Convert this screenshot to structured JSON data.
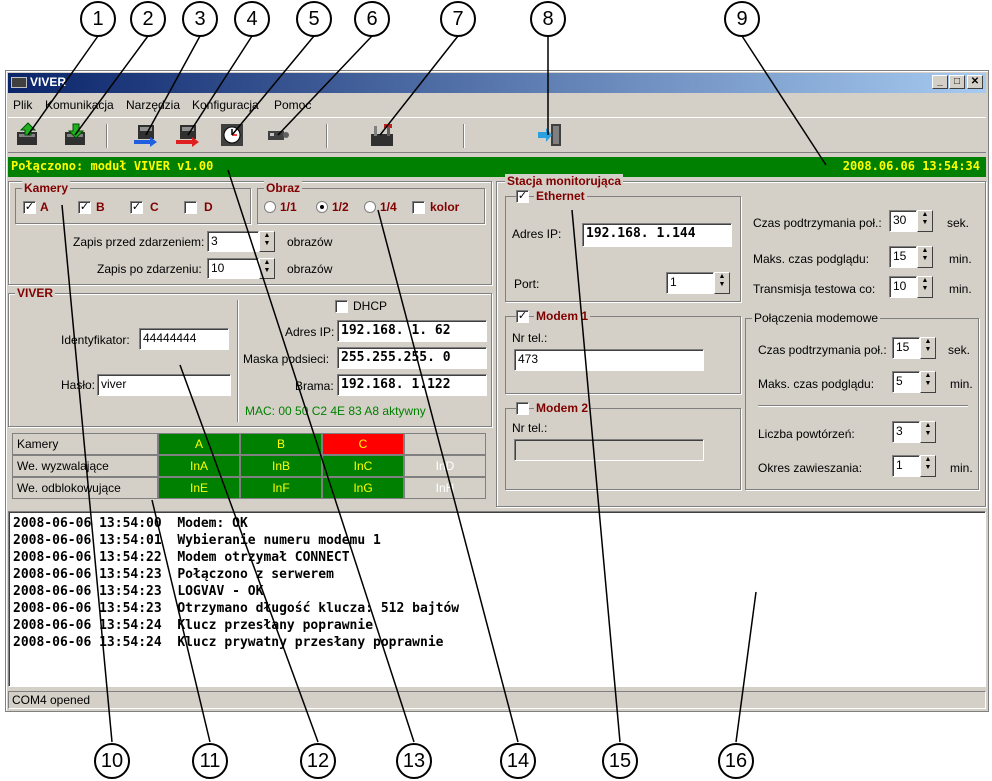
{
  "callouts": [
    "1",
    "2",
    "3",
    "4",
    "5",
    "6",
    "7",
    "8",
    "9",
    "10",
    "11",
    "12",
    "13",
    "14",
    "15",
    "16"
  ],
  "window": {
    "title": "VIVER",
    "controls": [
      "_",
      "□",
      "✕"
    ]
  },
  "menu": [
    "Plik",
    "Komunikacja",
    "Narzędzia",
    "Konfiguracja",
    "Pomoc"
  ],
  "toolbar": [
    "upload-icon",
    "download-icon",
    "send-blue-icon",
    "send-red-icon",
    "clock-icon",
    "camera-icon",
    "tools-icon",
    "exit-icon"
  ],
  "status": {
    "connected": "Połączono: moduł VIVER v1.00",
    "datetime": "2008.06.06  13:54:34"
  },
  "kamery": {
    "title": "Kamery",
    "items": [
      {
        "label": "A",
        "checked": true
      },
      {
        "label": "B",
        "checked": true
      },
      {
        "label": "C",
        "checked": true
      },
      {
        "label": "D",
        "checked": false
      }
    ],
    "before_label": "Zapis przed zdarzeniem:",
    "before_value": "3",
    "after_label": "Zapis po zdarzeniu:",
    "after_value": "10",
    "unit": "obrazów"
  },
  "obraz": {
    "title": "Obraz",
    "options": [
      "1/1",
      "1/2",
      "1/4"
    ],
    "selected": "1/2",
    "color_label": "kolor"
  },
  "viver": {
    "title": "VIVER",
    "id_label": "Identyfikator:",
    "id_value": "44444444",
    "pass_label": "Hasło:",
    "pass_value": "viver",
    "dhcp_label": "DHCP",
    "ip_label": "Adres IP:",
    "ip_value": "192.168.   1. 62",
    "mask_label": "Maska podsieci:",
    "mask_value": "255.255.255.  0",
    "gateway_label": "Brama:",
    "gateway_value": "192.168.   1.122",
    "mac": "MAC: 00 50 C2 4E 83 A8  aktywny"
  },
  "grid": {
    "rows": [
      "Kamery",
      "We. wyzwalające",
      "We. odblokowujące"
    ],
    "cells": [
      [
        "A",
        "B",
        "C",
        ""
      ],
      [
        "InA",
        "InB",
        "InC",
        "InD"
      ],
      [
        "InE",
        "InF",
        "InG",
        "InH"
      ]
    ],
    "colors": {
      "green": "#008000",
      "red": "#ff0000",
      "grey": "#d4d0c8"
    }
  },
  "stacja": {
    "title": "Stacja monitorująca",
    "ethernet_label": "Ethernet",
    "ip_label": "Adres IP:",
    "ip_value": "192.168.   1.144",
    "port_label": "Port:",
    "port_value": "1",
    "keep_label": "Czas podtrzymania poł.:",
    "keep_value": "30",
    "keep_unit": "sek.",
    "preview_label": "Maks. czas podglądu:",
    "preview_value": "15",
    "preview_unit": "min.",
    "test_label": "Transmisja testowa co:",
    "test_value": "10",
    "test_unit": "min.",
    "modem1_label": "Modem 1",
    "modem1_tel_label": "Nr tel.:",
    "modem1_tel_value": "473",
    "modem2_label": "Modem 2",
    "modem2_tel_label": "Nr tel.:",
    "modem_conn_title": "Połączenia modemowe",
    "m_keep_label": "Czas podtrzymania poł.:",
    "m_keep_value": "15",
    "m_keep_unit": "sek.",
    "m_preview_label": "Maks. czas podglądu:",
    "m_preview_value": "5",
    "m_preview_unit": "min.",
    "retries_label": "Liczba powtórzeń:",
    "retries_value": "3",
    "hang_label": "Okres zawieszania:",
    "hang_value": "1",
    "hang_unit": "min."
  },
  "log": [
    "2008-06-06 13:54:00  Modem: OK",
    "2008-06-06 13:54:01  Wybieranie numeru modemu 1",
    "2008-06-06 13:54:22  Modem otrzymał CONNECT",
    "2008-06-06 13:54:23  Połączono z serwerem",
    "2008-06-06 13:54:23  LOGVAV - OK",
    "2008-06-06 13:54:23  Otrzymano długość klucza: 512 bajtów",
    "2008-06-06 13:54:24  Klucz przesłany poprawnie",
    "2008-06-06 13:54:24  Klucz prywatny przesłany poprawnie"
  ],
  "statusbar": "COM4 opened"
}
